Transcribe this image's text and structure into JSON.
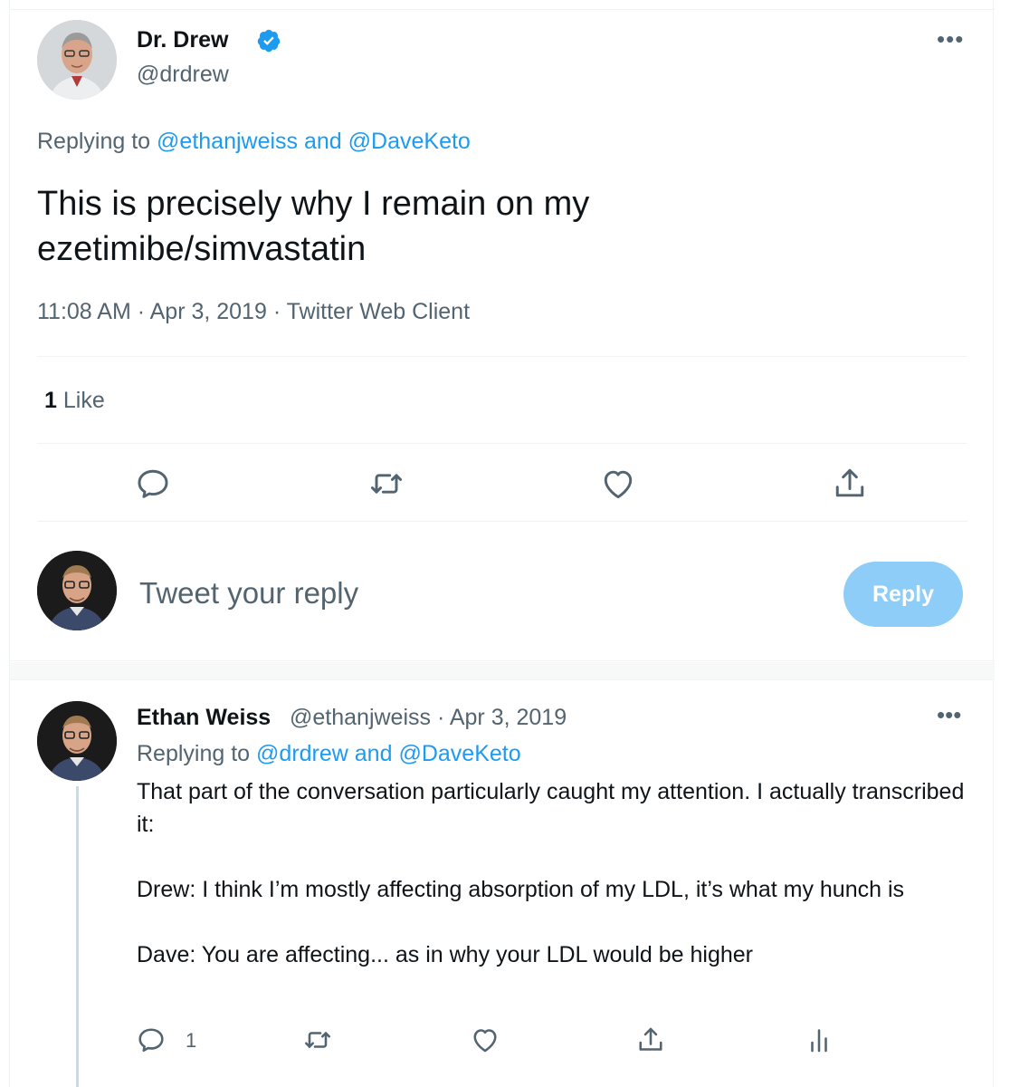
{
  "main_tweet": {
    "author_name": "Dr. Drew",
    "author_handle": "@drdrew",
    "replying_prefix": "Replying to",
    "replying_to_1": "@ethanjweiss",
    "replying_and": "and",
    "replying_to_2": "@DaveKeto",
    "text": "This is precisely why I remain on my ezetimibe/simvastatin",
    "meta": "11:08 AM · Apr 3, 2019 · Twitter Web Client",
    "like_count": "1",
    "like_label": "Like",
    "more_label": "•••"
  },
  "reply_box": {
    "placeholder": "Tweet your reply",
    "button_label": "Reply"
  },
  "reply_tweet": {
    "author_name": "Ethan Weiss",
    "handle_and_date": "@ethanjweiss · Apr 3, 2019",
    "replying_prefix": "Replying to",
    "replying_to_1": "@drdrew",
    "replying_and": "and",
    "replying_to_2": "@DaveKeto",
    "paragraphs": [
      "That part of the conversation particularly caught my attention. I actually transcribed it:",
      "Drew: I think I’m mostly affecting absorption of my LDL, it’s what my hunch is",
      "Dave: You are affecting... as in why your LDL would be higher"
    ],
    "reply_count": "1",
    "more_label": "•••"
  },
  "colors": {
    "accent": "#1d9bf0",
    "reply_button_disabled": "#8ecdf8",
    "secondary_text": "#536471"
  },
  "icons": [
    "verified-badge-icon",
    "more-icon",
    "reply-icon",
    "retweet-icon",
    "like-icon",
    "share-icon",
    "analytics-icon"
  ]
}
